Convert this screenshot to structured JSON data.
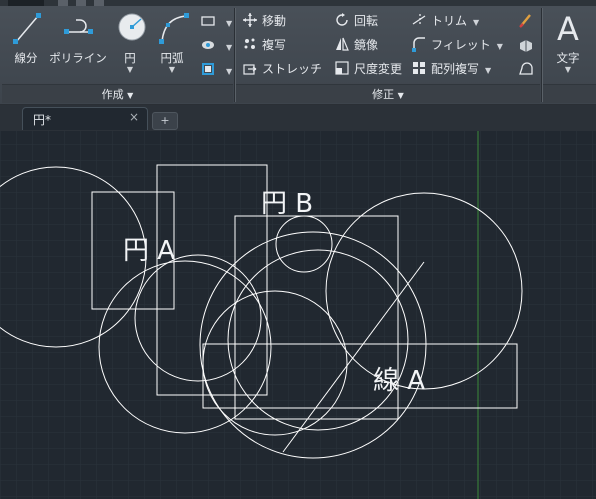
{
  "ribbon": {
    "draw_panel": {
      "title": "作成",
      "tools": [
        {
          "id": "line",
          "label": "線分",
          "icon": "line-icon"
        },
        {
          "id": "polyline",
          "label": "ポリライン",
          "icon": "polyline-icon"
        },
        {
          "id": "circle",
          "label": "円",
          "icon": "circle-icon"
        },
        {
          "id": "arc",
          "label": "円弧",
          "icon": "arc-icon"
        }
      ]
    },
    "modify_panel": {
      "title": "修正",
      "tools": [
        {
          "id": "move",
          "label": "移動",
          "icon": "move-icon"
        },
        {
          "id": "rotate",
          "label": "回転",
          "icon": "rotate-icon"
        },
        {
          "id": "trim",
          "label": "トリム",
          "icon": "trim-icon"
        },
        {
          "id": "copy",
          "label": "複写",
          "icon": "copy-icon"
        },
        {
          "id": "mirror",
          "label": "鏡像",
          "icon": "mirror-icon"
        },
        {
          "id": "fillet",
          "label": "フィレット",
          "icon": "fillet-icon"
        },
        {
          "id": "stretch",
          "label": "ストレッチ",
          "icon": "stretch-icon"
        },
        {
          "id": "scale",
          "label": "尺度変更",
          "icon": "scale-icon"
        },
        {
          "id": "array",
          "label": "配列複写",
          "icon": "array-icon"
        }
      ]
    },
    "annotation_panel": {
      "tools": [
        {
          "id": "text",
          "label": "文字",
          "icon": "text-icon"
        }
      ]
    }
  },
  "tabs": {
    "document_tab": "円*",
    "close_glyph": "×",
    "new_tab_glyph": "+"
  },
  "drawing": {
    "labels": {
      "circle_a": "円 A",
      "circle_b": "円 B",
      "line_a": "線 A"
    }
  },
  "colors": {
    "ribbon_bg": "#434a52",
    "canvas_bg": "#212830",
    "geometry": "#ffffff",
    "ucs_y_axis": "#3a8a3a"
  }
}
